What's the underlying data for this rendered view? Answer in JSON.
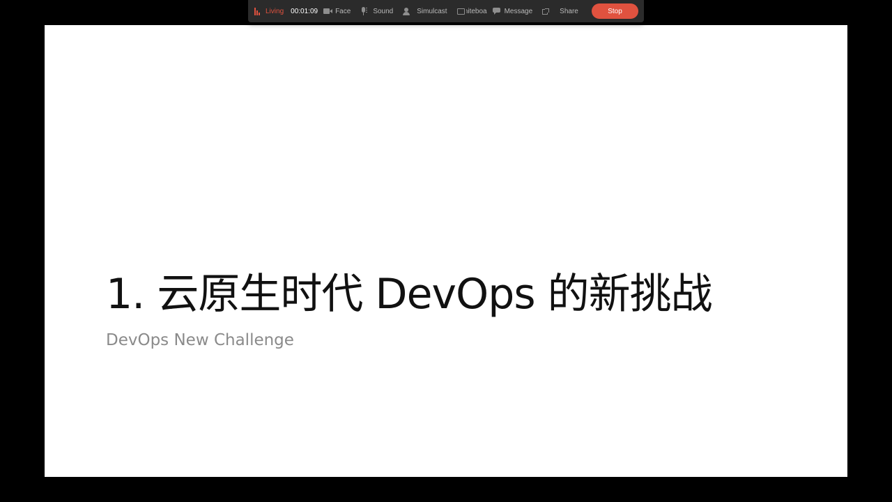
{
  "control_bar": {
    "status_label": "Living",
    "status_icon": "bar-chart-icon",
    "timer": "00:01:09",
    "face_label": "Face",
    "face_icon": "camera-icon",
    "sound_label": "Sound",
    "sound_icon": "microphone-icon",
    "simulcast_label": "Simulcast",
    "simulcast_icon": "person-icon",
    "whiteboard_label": "Whiteboa",
    "whiteboard_icon": "whiteboard-icon",
    "message_label": "Message",
    "message_icon": "message-icon",
    "share_label": "Share",
    "share_icon": "external-link-icon",
    "stop_label": "Stop",
    "accent_color": "#e0523f"
  },
  "slide": {
    "title": "1. 云原生时代 DevOps 的新挑战",
    "subtitle": "DevOps New Challenge"
  }
}
